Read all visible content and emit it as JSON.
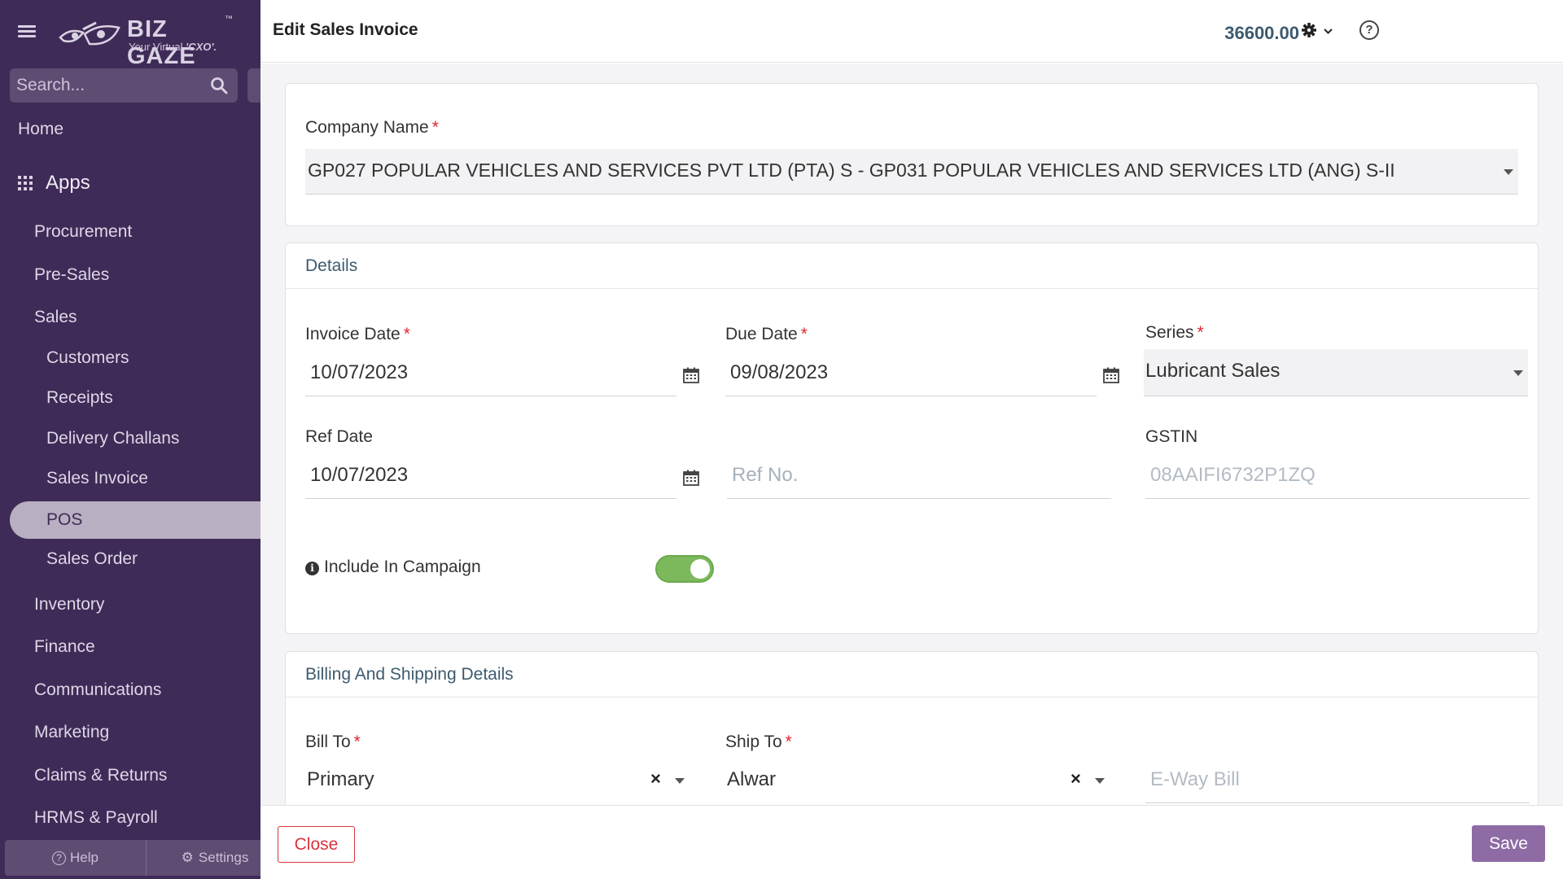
{
  "sidebar": {
    "logo": {
      "name": "BIZ GAZE",
      "tm": "™",
      "tagline_prefix": "Your Virtual ",
      "tagline_bold": "'CXO'."
    },
    "search_placeholder": "Search...",
    "home": "Home",
    "apps": "Apps",
    "items": [
      {
        "label": "Procurement"
      },
      {
        "label": "Pre-Sales"
      },
      {
        "label": "Sales"
      },
      {
        "label": "Customers"
      },
      {
        "label": "Receipts"
      },
      {
        "label": "Delivery Challans"
      },
      {
        "label": "Sales Invoice"
      },
      {
        "label": "POS"
      },
      {
        "label": "Sales Order"
      },
      {
        "label": "Inventory"
      },
      {
        "label": "Finance"
      },
      {
        "label": "Communications"
      },
      {
        "label": "Marketing"
      },
      {
        "label": "Claims & Returns"
      },
      {
        "label": "HRMS & Payroll"
      }
    ],
    "help": "Help",
    "settings": "Settings"
  },
  "header": {
    "title": "Edit Sales Invoice",
    "amount": "36600.00",
    "help_glyph": "?"
  },
  "form": {
    "company": {
      "label": "Company Name",
      "required": "*",
      "value": "GP027 POPULAR VEHICLES AND SERVICES PVT LTD (PTA) S - GP031 POPULAR VEHICLES AND SERVICES LTD (ANG) S-II"
    },
    "details": {
      "title": "Details",
      "invoice_date": {
        "label": "Invoice Date",
        "value": "10/07/2023"
      },
      "due_date": {
        "label": "Due Date",
        "value": "09/08/2023"
      },
      "series": {
        "label": "Series",
        "value": "Lubricant Sales"
      },
      "ref_date": {
        "label": "Ref Date",
        "value": "10/07/2023"
      },
      "ref_no": {
        "placeholder": "Ref No."
      },
      "gstin": {
        "label": "GSTIN",
        "placeholder": "08AAIFI6732P1ZQ"
      },
      "campaign": {
        "label": "Include In Campaign",
        "info_glyph": "i",
        "enabled": true
      }
    },
    "billing": {
      "title": "Billing And Shipping Details",
      "bill_to": {
        "label": "Bill To",
        "value": "Primary"
      },
      "ship_to": {
        "label": "Ship To",
        "value": "Alwar"
      },
      "eway": {
        "placeholder": "E-Way Bill"
      },
      "clear_glyph": "×"
    }
  },
  "footer": {
    "close": "Close",
    "save": "Save"
  },
  "colors": {
    "sidebar_bg": "#3f2b57",
    "accent": "#8e6ba5",
    "required": "#e0262e",
    "section_title": "#3d5a6e",
    "toggle_on": "#7cb95c"
  },
  "icons": [
    "hamburger-icon",
    "bizgaze-logo-icon",
    "search-icon",
    "apps-grid-icon",
    "help-circle-icon",
    "gear-icon",
    "chevron-down-icon",
    "calendar-icon",
    "caret-down-icon",
    "info-icon",
    "clear-icon"
  ]
}
